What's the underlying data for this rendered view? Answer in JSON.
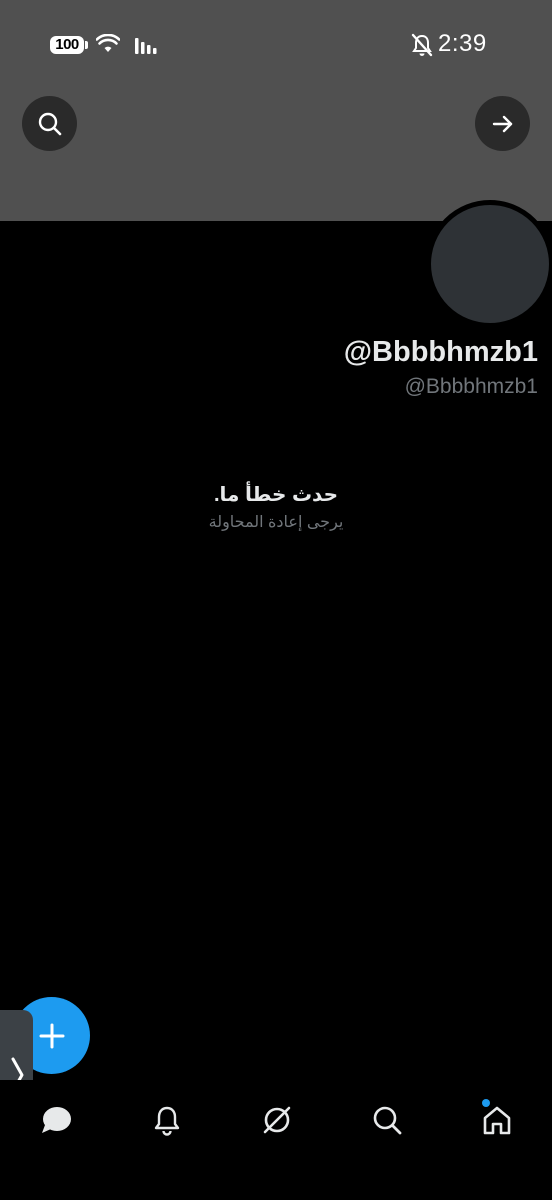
{
  "status_bar": {
    "battery": "100",
    "time": "2:39"
  },
  "header": {
    "search_icon": "search-icon",
    "forward_icon": "arrow-right-icon"
  },
  "profile": {
    "display_name": "@Bbbbhmzb1",
    "handle": "@Bbbbhmzb1"
  },
  "error": {
    "title": "حدث خطأ ما.",
    "subtitle": "يرجى إعادة المحاولة"
  },
  "nav": {
    "items": [
      "messages-icon",
      "bell-icon",
      "grok-icon",
      "search-icon",
      "home-icon"
    ]
  },
  "colors": {
    "accent": "#1d9bf0",
    "banner": "#505050",
    "background": "#000000"
  }
}
